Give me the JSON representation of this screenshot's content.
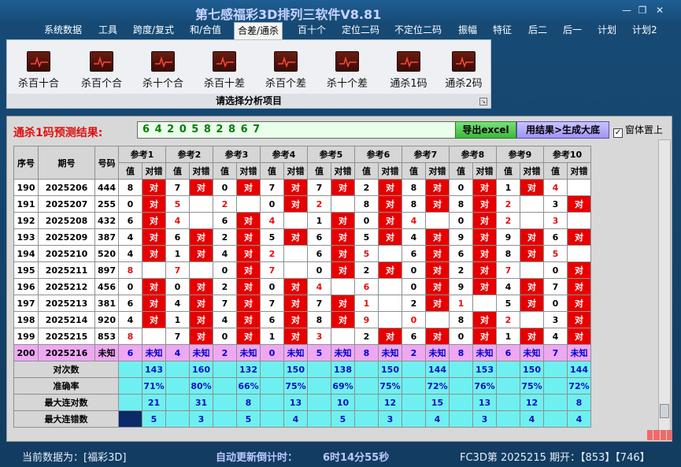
{
  "window": {
    "title": "第七感福彩3D排列三软件V8.81"
  },
  "menu": [
    {
      "label": "系统数据"
    },
    {
      "label": "工具"
    },
    {
      "label": "跨度/复式"
    },
    {
      "label": "和/合值"
    },
    {
      "label": "合差/通杀",
      "active": true
    },
    {
      "label": "百十个"
    },
    {
      "label": "定位二码"
    },
    {
      "label": "不定位二码"
    },
    {
      "label": "振幅"
    },
    {
      "label": "特征"
    },
    {
      "label": "后二"
    },
    {
      "label": "后一"
    },
    {
      "label": "计划"
    },
    {
      "label": "计划2"
    }
  ],
  "ribbon": {
    "buttons": [
      {
        "label": "杀百十合",
        "icon": "chart-icon"
      },
      {
        "label": "杀百个合",
        "icon": "chart-icon"
      },
      {
        "label": "杀十个合",
        "icon": "chart-icon"
      },
      {
        "label": "杀百十差",
        "icon": "chart-icon"
      },
      {
        "label": "杀百个差",
        "icon": "chart-icon"
      },
      {
        "label": "杀十个差",
        "icon": "chart-icon"
      },
      {
        "label": "通杀1码",
        "icon": "chart-icon"
      },
      {
        "label": "通杀2码",
        "icon": "chart-icon"
      }
    ],
    "caption": "请选择分析项目"
  },
  "result": {
    "label": "通杀1码预测结果:",
    "value": "6 4 2 0 5 8 2 8 6 7",
    "export_label": "导出excel",
    "generate_label": "用结果>生成大底",
    "topmost_label": "窗体置上",
    "topmost_checked": "✓"
  },
  "table": {
    "headers": {
      "seq": "序号",
      "period": "期号",
      "number": "号码",
      "val": "值",
      "hitcol": "对错"
    },
    "refs": [
      "参考1",
      "参考2",
      "参考3",
      "参考4",
      "参考5",
      "参考6",
      "参考7",
      "参考8",
      "参考9",
      "参考10"
    ],
    "hit_text": "对",
    "unknown_text": "未知",
    "rows": [
      {
        "seq": "190",
        "period": "2025206",
        "num": "444",
        "cells": [
          [
            "8",
            1,
            0
          ],
          [
            "7",
            1,
            0
          ],
          [
            "0",
            1,
            0
          ],
          [
            "7",
            1,
            0
          ],
          [
            "7",
            1,
            0
          ],
          [
            "2",
            1,
            0
          ],
          [
            "8",
            1,
            0
          ],
          [
            "0",
            1,
            0
          ],
          [
            "1",
            1,
            0
          ],
          [
            "4",
            0,
            1
          ]
        ]
      },
      {
        "seq": "191",
        "period": "2025207",
        "num": "255",
        "cells": [
          [
            "0",
            1,
            0
          ],
          [
            "5",
            0,
            1
          ],
          [
            "2",
            0,
            1
          ],
          [
            "0",
            1,
            0
          ],
          [
            "2",
            0,
            1
          ],
          [
            "8",
            1,
            0
          ],
          [
            "8",
            1,
            0
          ],
          [
            "8",
            1,
            0
          ],
          [
            "2",
            0,
            1
          ],
          [
            "3",
            1,
            0
          ]
        ]
      },
      {
        "seq": "192",
        "period": "2025208",
        "num": "432",
        "cells": [
          [
            "6",
            1,
            0
          ],
          [
            "4",
            0,
            1
          ],
          [
            "6",
            1,
            0
          ],
          [
            "4",
            0,
            1
          ],
          [
            "1",
            1,
            0
          ],
          [
            "0",
            1,
            0
          ],
          [
            "4",
            0,
            1
          ],
          [
            "0",
            1,
            0
          ],
          [
            "2",
            0,
            1
          ],
          [
            "3",
            0,
            1
          ]
        ]
      },
      {
        "seq": "193",
        "period": "2025209",
        "num": "387",
        "cells": [
          [
            "4",
            1,
            0
          ],
          [
            "6",
            1,
            0
          ],
          [
            "2",
            1,
            0
          ],
          [
            "5",
            1,
            0
          ],
          [
            "6",
            1,
            0
          ],
          [
            "5",
            1,
            0
          ],
          [
            "4",
            1,
            0
          ],
          [
            "9",
            1,
            0
          ],
          [
            "9",
            1,
            0
          ],
          [
            "6",
            1,
            0
          ]
        ]
      },
      {
        "seq": "194",
        "period": "2025210",
        "num": "520",
        "cells": [
          [
            "4",
            1,
            0
          ],
          [
            "1",
            1,
            0
          ],
          [
            "4",
            1,
            0
          ],
          [
            "2",
            0,
            1
          ],
          [
            "6",
            1,
            0
          ],
          [
            "5",
            0,
            1
          ],
          [
            "6",
            1,
            0
          ],
          [
            "6",
            1,
            0
          ],
          [
            "8",
            1,
            0
          ],
          [
            "5",
            0,
            1
          ]
        ]
      },
      {
        "seq": "195",
        "period": "2025211",
        "num": "897",
        "cells": [
          [
            "8",
            0,
            1
          ],
          [
            "7",
            0,
            1
          ],
          [
            "0",
            1,
            0
          ],
          [
            "7",
            0,
            1
          ],
          [
            "0",
            1,
            0
          ],
          [
            "2",
            1,
            0
          ],
          [
            "0",
            1,
            0
          ],
          [
            "2",
            1,
            0
          ],
          [
            "7",
            0,
            1
          ],
          [
            "0",
            1,
            0
          ]
        ]
      },
      {
        "seq": "196",
        "period": "2025212",
        "num": "456",
        "cells": [
          [
            "0",
            1,
            0
          ],
          [
            "0",
            1,
            0
          ],
          [
            "2",
            1,
            0
          ],
          [
            "0",
            1,
            0
          ],
          [
            "4",
            0,
            1
          ],
          [
            "6",
            0,
            1
          ],
          [
            "0",
            1,
            0
          ],
          [
            "9",
            1,
            0
          ],
          [
            "4",
            1,
            0
          ],
          [
            "7",
            1,
            0
          ]
        ]
      },
      {
        "seq": "197",
        "period": "2025213",
        "num": "381",
        "cells": [
          [
            "6",
            1,
            0
          ],
          [
            "4",
            1,
            0
          ],
          [
            "7",
            1,
            0
          ],
          [
            "7",
            1,
            0
          ],
          [
            "7",
            1,
            0
          ],
          [
            "1",
            0,
            1
          ],
          [
            "2",
            1,
            0
          ],
          [
            "1",
            0,
            1
          ],
          [
            "5",
            1,
            0
          ],
          [
            "0",
            1,
            0
          ]
        ]
      },
      {
        "seq": "198",
        "period": "2025214",
        "num": "920",
        "cells": [
          [
            "4",
            1,
            0
          ],
          [
            "1",
            1,
            0
          ],
          [
            "4",
            1,
            0
          ],
          [
            "6",
            1,
            0
          ],
          [
            "8",
            1,
            0
          ],
          [
            "9",
            0,
            1
          ],
          [
            "0",
            0,
            1
          ],
          [
            "8",
            1,
            0
          ],
          [
            "2",
            0,
            1
          ],
          [
            "3",
            1,
            0
          ]
        ]
      },
      {
        "seq": "199",
        "period": "2025215",
        "num": "853",
        "cells": [
          [
            "8",
            0,
            1
          ],
          [
            "7",
            1,
            0
          ],
          [
            "0",
            1,
            0
          ],
          [
            "1",
            1,
            0
          ],
          [
            "3",
            0,
            1
          ],
          [
            "2",
            1,
            0
          ],
          [
            "6",
            1,
            0
          ],
          [
            "0",
            1,
            0
          ],
          [
            "1",
            1,
            0
          ],
          [
            "4",
            1,
            0
          ]
        ]
      }
    ],
    "prediction_row": {
      "seq": "200",
      "period": "2025216",
      "num": "未知",
      "values": [
        "6",
        "4",
        "2",
        "0",
        "5",
        "8",
        "2",
        "8",
        "6",
        "7"
      ]
    },
    "stats": [
      {
        "label": "对次数",
        "values": [
          "143",
          "160",
          "132",
          "150",
          "138",
          "150",
          "144",
          "153",
          "150",
          "144"
        ]
      },
      {
        "label": "准确率",
        "values": [
          "71%",
          "80%",
          "66%",
          "75%",
          "69%",
          "75%",
          "72%",
          "76%",
          "75%",
          "72%"
        ]
      },
      {
        "label": "最大连对数",
        "values": [
          "21",
          "31",
          "8",
          "13",
          "10",
          "12",
          "15",
          "13",
          "12",
          "8"
        ]
      },
      {
        "label": "最大连错数",
        "values": [
          "5",
          "3",
          "5",
          "4",
          "5",
          "3",
          "4",
          "3",
          "4",
          "4"
        ]
      }
    ]
  },
  "status": {
    "current_data": "当前数据为：[福彩3D]",
    "countdown_label": "自动更新倒计时：",
    "countdown_value": "6时14分55秒",
    "draw_info": "FC3D第 2025215 期开：【853】【746】"
  },
  "colors": {
    "hit": "#e60000",
    "stat_bg": "#6ff0f0",
    "predict_bg": "#eea8f2",
    "title": "#c9d3ff"
  }
}
